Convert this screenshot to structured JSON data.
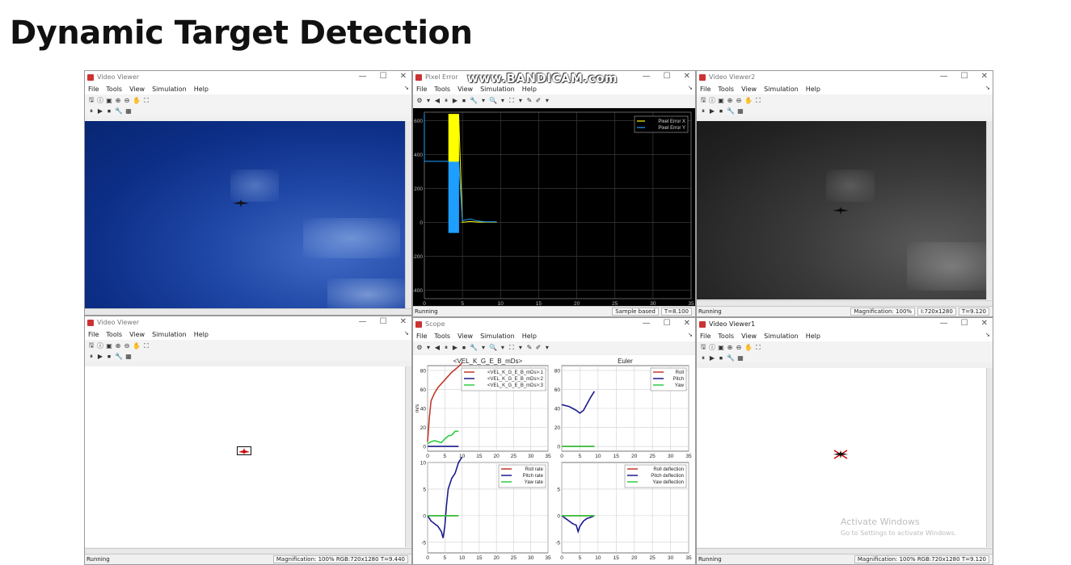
{
  "page_title": "Dynamic Target Detection",
  "recorder_watermark": "www.BANDICAM.com",
  "os_watermark": {
    "line1": "Activate Windows",
    "line2": "Go to Settings to activate Windows."
  },
  "window_controls": {
    "minimize": "—",
    "maximize": "☐",
    "close": "✕"
  },
  "video_menu": [
    "File",
    "Tools",
    "View",
    "Simulation",
    "Help"
  ],
  "scope_menu": [
    "File",
    "Tools",
    "View",
    "Simulation",
    "Help"
  ],
  "video_toolbar": [
    "🖫",
    "ⓘ",
    "▣",
    "⊕",
    "⊖",
    "✋",
    "⛶"
  ],
  "video_sim_toolbar": [
    "⏸",
    "▶",
    "⏹",
    "🔧",
    "▦"
  ],
  "scope_toolbar": [
    "⚙",
    "▾",
    "◀",
    "⏸",
    "▶",
    "⏹",
    "🔧",
    "▾",
    "🔍",
    "▾",
    "⛶",
    "▾",
    "✎",
    "✐",
    "▾"
  ],
  "windows": {
    "video_viewer_tl": {
      "title": "Video Viewer"
    },
    "pixel_error": {
      "title": "Pixel Error",
      "status_left": "Running",
      "status_mode": "Sample based",
      "status_time": "T=8.100"
    },
    "video_viewer2": {
      "title": "Video Viewer2",
      "status_left": "Running",
      "status_mag": "Magnification: 100%",
      "status_size": "I:720x1280",
      "status_time": "T=9.120"
    },
    "video_viewer_bl": {
      "title": "Video Viewer",
      "status_left": "Running",
      "status_right": "Magnification: 100%   RGB:720x1280   T=9.440"
    },
    "scope": {
      "title": "Scope"
    },
    "video_viewer1": {
      "title": "Video Viewer1",
      "status_left": "Running",
      "status_right": "Magnification: 100%   RGB:720x1280   T=9.120"
    }
  },
  "chart_data": [
    {
      "type": "line",
      "window": "Pixel Error",
      "title": "",
      "x_ticks": [
        0,
        5,
        10,
        15,
        20,
        25,
        30,
        35
      ],
      "y_ticks": [
        600,
        400,
        200,
        0,
        -200,
        -400
      ],
      "xlim": [
        0,
        35
      ],
      "ylim": [
        -450,
        650
      ],
      "grid": true,
      "legend": "top-right",
      "series": [
        {
          "name": "Pixel Error X",
          "color": "#ffff00",
          "x": [
            3.2,
            3.2,
            4.5,
            4.5,
            5,
            6,
            7,
            8,
            9.5
          ],
          "y": [
            640,
            360,
            360,
            640,
            0,
            5,
            2,
            2,
            2
          ]
        },
        {
          "name": "Pixel Error Y",
          "color": "#1e9fff",
          "x": [
            0,
            0,
            3.2,
            3.2,
            4.5,
            4.5,
            5,
            6,
            7,
            8,
            9.5
          ],
          "y": [
            640,
            360,
            360,
            -60,
            -60,
            360,
            10,
            20,
            8,
            4,
            4
          ]
        }
      ]
    },
    {
      "type": "line",
      "window": "Scope",
      "title": "<VEL_K_G_E_B_mDs>",
      "ylabel": "m/s",
      "x_ticks": [
        0,
        5,
        10,
        15,
        20,
        25,
        30,
        35
      ],
      "y_ticks": [
        80,
        60,
        40,
        20,
        0
      ],
      "xlim": [
        0,
        35
      ],
      "ylim": [
        -5,
        85
      ],
      "grid": true,
      "legend": "top-right",
      "series": [
        {
          "name": "<VEL_K_G_E_B_mDs>:1",
          "color": "#c0392b",
          "x": [
            0,
            0.5,
            1,
            2,
            3,
            5,
            7,
            9,
            10
          ],
          "y": [
            5,
            30,
            48,
            56,
            62,
            70,
            78,
            84,
            88
          ]
        },
        {
          "name": "<VEL_K_G_E_B_mDs>:2",
          "color": "#1a1a8c",
          "x": [
            0,
            2,
            5,
            9
          ],
          "y": [
            0,
            0,
            0,
            0
          ]
        },
        {
          "name": "<VEL_K_G_E_B_mDs>:3",
          "color": "#2ecc40",
          "x": [
            0,
            1,
            2,
            3,
            4,
            5,
            6,
            7,
            8,
            9
          ],
          "y": [
            3,
            5,
            6,
            5,
            4,
            8,
            11,
            12,
            16,
            16
          ]
        }
      ]
    },
    {
      "type": "line",
      "window": "Scope",
      "title": "Euler",
      "x_ticks": [
        0,
        5,
        10,
        15,
        20,
        25,
        30,
        35
      ],
      "y_ticks": [
        80,
        60,
        40,
        20,
        0
      ],
      "xlim": [
        0,
        35
      ],
      "ylim": [
        -5,
        85
      ],
      "grid": true,
      "legend": "top-right",
      "series": [
        {
          "name": "Roll",
          "color": "#c0392b",
          "x": [
            0,
            9
          ],
          "y": [
            0,
            0
          ]
        },
        {
          "name": "Pitch",
          "color": "#1a1a8c",
          "x": [
            0,
            1,
            2,
            3,
            4,
            5,
            6,
            7,
            8,
            9
          ],
          "y": [
            44,
            43,
            42,
            40,
            38,
            35,
            38,
            45,
            52,
            58
          ]
        },
        {
          "name": "Yaw",
          "color": "#2ecc40",
          "x": [
            0,
            9
          ],
          "y": [
            0,
            0
          ]
        }
      ]
    },
    {
      "type": "line",
      "window": "Scope",
      "title": "",
      "x_ticks": [
        0,
        5,
        10,
        15,
        20,
        25,
        30,
        35
      ],
      "y_ticks": [
        10,
        5,
        0,
        -5
      ],
      "xlim": [
        0,
        35
      ],
      "ylim": [
        -7,
        10
      ],
      "grid": true,
      "legend": "top-right",
      "series": [
        {
          "name": "Roll rate",
          "color": "#c0392b",
          "x": [
            0,
            9
          ],
          "y": [
            0,
            0
          ]
        },
        {
          "name": "Pitch rate",
          "color": "#1a1a8c",
          "x": [
            0,
            0.5,
            1,
            2,
            3,
            4,
            4.5,
            5,
            5.5,
            6,
            7,
            8,
            9,
            10
          ],
          "y": [
            0,
            -0.5,
            -1,
            -1.5,
            -2,
            -3,
            -4.2,
            -2,
            2,
            5,
            7,
            8,
            10,
            11
          ]
        },
        {
          "name": "Yaw rate",
          "color": "#2ecc40",
          "x": [
            0,
            9
          ],
          "y": [
            0,
            0
          ]
        }
      ]
    },
    {
      "type": "line",
      "window": "Scope",
      "title": "",
      "x_ticks": [
        0,
        5,
        10,
        15,
        20,
        25,
        30,
        35
      ],
      "y_ticks": [
        5,
        0,
        -5
      ],
      "xlim": [
        0,
        35
      ],
      "ylim": [
        -7,
        10
      ],
      "grid": true,
      "legend": "top-right",
      "series": [
        {
          "name": "Roll deflection",
          "color": "#c0392b",
          "x": [
            0,
            9
          ],
          "y": [
            0,
            0
          ]
        },
        {
          "name": "Pitch deflection",
          "color": "#1a1a8c",
          "x": [
            0,
            1,
            2,
            3,
            4,
            4.5,
            5,
            6,
            7,
            8,
            9
          ],
          "y": [
            0,
            -0.5,
            -1,
            -1.5,
            -1.8,
            -3,
            -2,
            -1,
            -0.5,
            -0.3,
            0
          ]
        },
        {
          "name": "Yaw deflection",
          "color": "#2ecc40",
          "x": [
            0,
            9
          ],
          "y": [
            0,
            0
          ]
        }
      ]
    }
  ]
}
